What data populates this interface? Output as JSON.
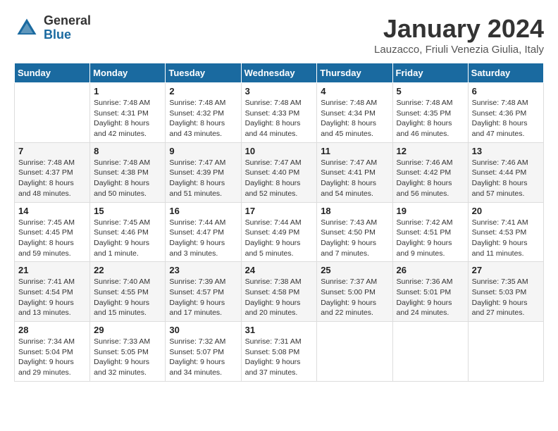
{
  "logo": {
    "general": "General",
    "blue": "Blue"
  },
  "title": "January 2024",
  "location": "Lauzacco, Friuli Venezia Giulia, Italy",
  "days_header": [
    "Sunday",
    "Monday",
    "Tuesday",
    "Wednesday",
    "Thursday",
    "Friday",
    "Saturday"
  ],
  "weeks": [
    [
      {
        "day": "",
        "info": ""
      },
      {
        "day": "1",
        "info": "Sunrise: 7:48 AM\nSunset: 4:31 PM\nDaylight: 8 hours\nand 42 minutes."
      },
      {
        "day": "2",
        "info": "Sunrise: 7:48 AM\nSunset: 4:32 PM\nDaylight: 8 hours\nand 43 minutes."
      },
      {
        "day": "3",
        "info": "Sunrise: 7:48 AM\nSunset: 4:33 PM\nDaylight: 8 hours\nand 44 minutes."
      },
      {
        "day": "4",
        "info": "Sunrise: 7:48 AM\nSunset: 4:34 PM\nDaylight: 8 hours\nand 45 minutes."
      },
      {
        "day": "5",
        "info": "Sunrise: 7:48 AM\nSunset: 4:35 PM\nDaylight: 8 hours\nand 46 minutes."
      },
      {
        "day": "6",
        "info": "Sunrise: 7:48 AM\nSunset: 4:36 PM\nDaylight: 8 hours\nand 47 minutes."
      }
    ],
    [
      {
        "day": "7",
        "info": "Sunrise: 7:48 AM\nSunset: 4:37 PM\nDaylight: 8 hours\nand 48 minutes."
      },
      {
        "day": "8",
        "info": "Sunrise: 7:48 AM\nSunset: 4:38 PM\nDaylight: 8 hours\nand 50 minutes."
      },
      {
        "day": "9",
        "info": "Sunrise: 7:47 AM\nSunset: 4:39 PM\nDaylight: 8 hours\nand 51 minutes."
      },
      {
        "day": "10",
        "info": "Sunrise: 7:47 AM\nSunset: 4:40 PM\nDaylight: 8 hours\nand 52 minutes."
      },
      {
        "day": "11",
        "info": "Sunrise: 7:47 AM\nSunset: 4:41 PM\nDaylight: 8 hours\nand 54 minutes."
      },
      {
        "day": "12",
        "info": "Sunrise: 7:46 AM\nSunset: 4:42 PM\nDaylight: 8 hours\nand 56 minutes."
      },
      {
        "day": "13",
        "info": "Sunrise: 7:46 AM\nSunset: 4:44 PM\nDaylight: 8 hours\nand 57 minutes."
      }
    ],
    [
      {
        "day": "14",
        "info": "Sunrise: 7:45 AM\nSunset: 4:45 PM\nDaylight: 8 hours\nand 59 minutes."
      },
      {
        "day": "15",
        "info": "Sunrise: 7:45 AM\nSunset: 4:46 PM\nDaylight: 9 hours\nand 1 minute."
      },
      {
        "day": "16",
        "info": "Sunrise: 7:44 AM\nSunset: 4:47 PM\nDaylight: 9 hours\nand 3 minutes."
      },
      {
        "day": "17",
        "info": "Sunrise: 7:44 AM\nSunset: 4:49 PM\nDaylight: 9 hours\nand 5 minutes."
      },
      {
        "day": "18",
        "info": "Sunrise: 7:43 AM\nSunset: 4:50 PM\nDaylight: 9 hours\nand 7 minutes."
      },
      {
        "day": "19",
        "info": "Sunrise: 7:42 AM\nSunset: 4:51 PM\nDaylight: 9 hours\nand 9 minutes."
      },
      {
        "day": "20",
        "info": "Sunrise: 7:41 AM\nSunset: 4:53 PM\nDaylight: 9 hours\nand 11 minutes."
      }
    ],
    [
      {
        "day": "21",
        "info": "Sunrise: 7:41 AM\nSunset: 4:54 PM\nDaylight: 9 hours\nand 13 minutes."
      },
      {
        "day": "22",
        "info": "Sunrise: 7:40 AM\nSunset: 4:55 PM\nDaylight: 9 hours\nand 15 minutes."
      },
      {
        "day": "23",
        "info": "Sunrise: 7:39 AM\nSunset: 4:57 PM\nDaylight: 9 hours\nand 17 minutes."
      },
      {
        "day": "24",
        "info": "Sunrise: 7:38 AM\nSunset: 4:58 PM\nDaylight: 9 hours\nand 20 minutes."
      },
      {
        "day": "25",
        "info": "Sunrise: 7:37 AM\nSunset: 5:00 PM\nDaylight: 9 hours\nand 22 minutes."
      },
      {
        "day": "26",
        "info": "Sunrise: 7:36 AM\nSunset: 5:01 PM\nDaylight: 9 hours\nand 24 minutes."
      },
      {
        "day": "27",
        "info": "Sunrise: 7:35 AM\nSunset: 5:03 PM\nDaylight: 9 hours\nand 27 minutes."
      }
    ],
    [
      {
        "day": "28",
        "info": "Sunrise: 7:34 AM\nSunset: 5:04 PM\nDaylight: 9 hours\nand 29 minutes."
      },
      {
        "day": "29",
        "info": "Sunrise: 7:33 AM\nSunset: 5:05 PM\nDaylight: 9 hours\nand 32 minutes."
      },
      {
        "day": "30",
        "info": "Sunrise: 7:32 AM\nSunset: 5:07 PM\nDaylight: 9 hours\nand 34 minutes."
      },
      {
        "day": "31",
        "info": "Sunrise: 7:31 AM\nSunset: 5:08 PM\nDaylight: 9 hours\nand 37 minutes."
      },
      {
        "day": "",
        "info": ""
      },
      {
        "day": "",
        "info": ""
      },
      {
        "day": "",
        "info": ""
      }
    ]
  ]
}
